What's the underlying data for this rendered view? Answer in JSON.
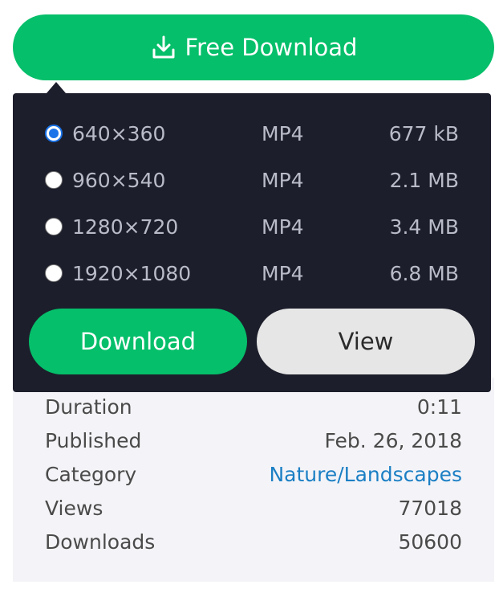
{
  "header": {
    "free_download_label": "Free Download",
    "icon": "download-icon"
  },
  "popup": {
    "options": [
      {
        "resolution": "640×360",
        "format": "MP4",
        "size": "677 kB",
        "selected": true
      },
      {
        "resolution": "960×540",
        "format": "MP4",
        "size": "2.1 MB",
        "selected": false
      },
      {
        "resolution": "1280×720",
        "format": "MP4",
        "size": "3.4 MB",
        "selected": false
      },
      {
        "resolution": "1920×1080",
        "format": "MP4",
        "size": "6.8 MB",
        "selected": false
      }
    ],
    "download_label": "Download",
    "view_label": "View"
  },
  "info": {
    "rows": [
      {
        "label": "Duration",
        "value": "0:11"
      },
      {
        "label": "Published",
        "value": "Feb. 26, 2018"
      },
      {
        "label": "Category",
        "value": "Nature/Landscapes"
      },
      {
        "label": "Views",
        "value": "77018"
      },
      {
        "label": "Downloads",
        "value": "50600"
      }
    ]
  },
  "colors": {
    "accent_green": "#05bf6a",
    "popup_bg": "#1c1e2b",
    "link_blue": "#1b7fc4",
    "panel_bg": "#f4f4f8"
  }
}
